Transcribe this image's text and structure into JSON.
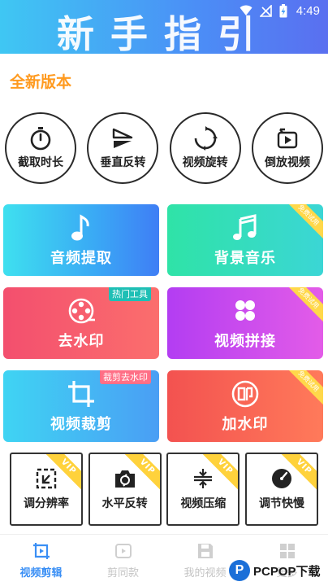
{
  "status_bar": {
    "time": "4:49"
  },
  "banner": {
    "title": "新手指引"
  },
  "section": {
    "title": "全新版本"
  },
  "circle_tools": [
    {
      "label": "截取时长",
      "icon": "stopwatch-icon"
    },
    {
      "label": "垂直反转",
      "icon": "flip-vertical-icon"
    },
    {
      "label": "视频旋转",
      "icon": "rotate-icon"
    },
    {
      "label": "倒放视频",
      "icon": "reverse-play-icon"
    }
  ],
  "cards": [
    {
      "label": "音频提取",
      "icon": "music-note-icon"
    },
    {
      "label": "背景音乐",
      "icon": "music-notes-icon",
      "ribbon": "免费试用"
    },
    {
      "label": "去水印",
      "icon": "film-reel-icon",
      "tag": "热门工具"
    },
    {
      "label": "视频拼接",
      "icon": "puzzle-icon",
      "ribbon": "免费试用"
    },
    {
      "label": "视频裁剪",
      "icon": "crop-icon",
      "tag": "裁剪去水印"
    },
    {
      "label": "加水印",
      "icon": "stamp-icon",
      "ribbon": "免费试用"
    }
  ],
  "small_tools": [
    {
      "label": "调分辨率",
      "icon": "resolution-icon",
      "badge": "VIP"
    },
    {
      "label": "水平反转",
      "icon": "camera-flip-icon",
      "badge": "VIP"
    },
    {
      "label": "视频压缩",
      "icon": "compress-icon",
      "badge": "VIP"
    },
    {
      "label": "调节快慢",
      "icon": "speed-gauge-icon",
      "badge": "VIP"
    }
  ],
  "bottom_nav": [
    {
      "label": "视频剪辑",
      "active": true
    },
    {
      "label": "剪同款"
    },
    {
      "label": "我的视频"
    },
    {
      "label": "更多"
    }
  ],
  "watermark": {
    "logo": "P",
    "text": "PCPOP下载"
  },
  "colors": {
    "accent": "#3a8ff5",
    "section_title": "#ff9a1f",
    "vip": "#ffd23c"
  }
}
